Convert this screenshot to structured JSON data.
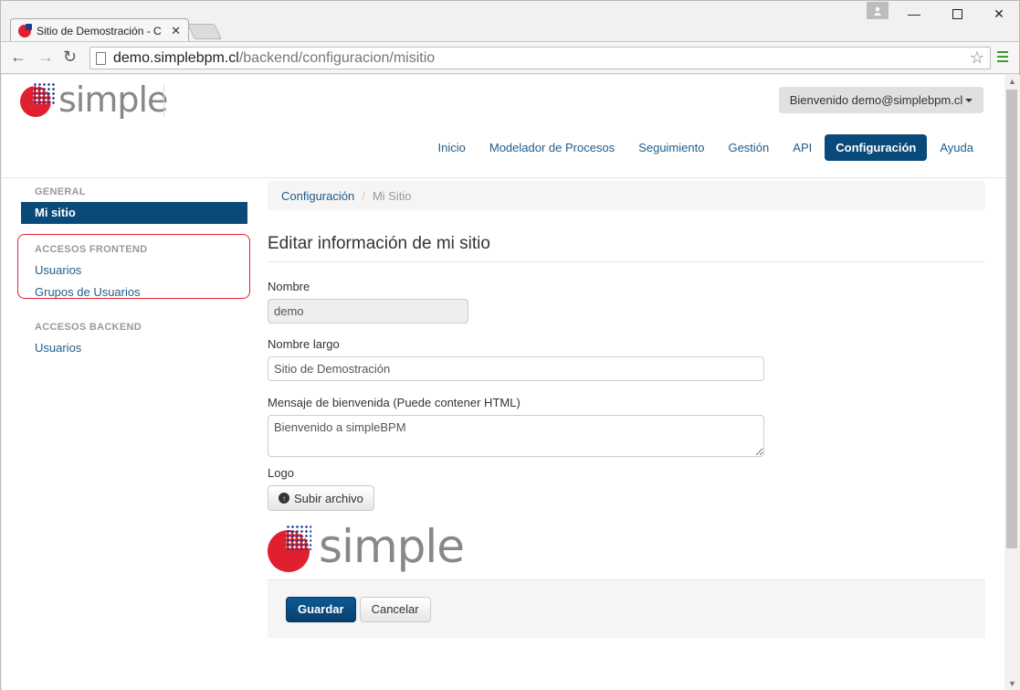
{
  "browser": {
    "tab_title": "Sitio de Demostración - C",
    "url_host": "demo.simplebpm.cl",
    "url_path": "/backend/configuracion/misitio"
  },
  "header": {
    "logo_text": "simple",
    "user_menu": "Bienvenido demo@simplebpm.cl",
    "nav": [
      "Inicio",
      "Modelador de Procesos",
      "Seguimiento",
      "Gestión",
      "API",
      "Configuración",
      "Ayuda"
    ],
    "nav_active": "Configuración"
  },
  "sidebar": {
    "sections": [
      {
        "title": "GENERAL",
        "items": [
          "Mi sitio"
        ]
      },
      {
        "title": "ACCESOS FRONTEND",
        "items": [
          "Usuarios",
          "Grupos de Usuarios"
        ]
      },
      {
        "title": "ACCESOS BACKEND",
        "items": [
          "Usuarios"
        ]
      }
    ],
    "active_item": "Mi sitio",
    "highlighted_section": "ACCESOS FRONTEND"
  },
  "breadcrumb": {
    "parent": "Configuración",
    "separator": "/",
    "current": "Mi Sitio"
  },
  "form": {
    "title": "Editar información de mi sitio",
    "nombre_label": "Nombre",
    "nombre_value": "demo",
    "nombre_largo_label": "Nombre largo",
    "nombre_largo_value": "Sitio de Demostración",
    "mensaje_label": "Mensaje de bienvenida (Puede contener HTML)",
    "mensaje_value": "Bienvenido a simpleBPM",
    "logo_label": "Logo",
    "upload_label": "Subir archivo",
    "logo_preview_text": "simple",
    "save_label": "Guardar",
    "cancel_label": "Cancelar"
  },
  "colors": {
    "brand_red": "#e0202e",
    "brand_blue": "#1a3f8f",
    "nav_active": "#0a4a7a",
    "link": "#1f5c8a",
    "highlight_outline": "#e0202e"
  }
}
